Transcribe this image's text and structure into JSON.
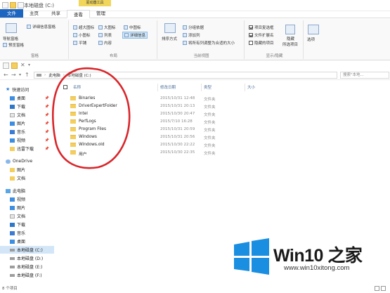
{
  "window": {
    "title": "本地磁盘 (C:)",
    "context_tab": "驱动器工具"
  },
  "ribbon_tabs": [
    "文件",
    "主页",
    "共享",
    "查看",
    "管理"
  ],
  "ribbon": {
    "panes": {
      "nav_pane": "导航窗格",
      "preview_pane": "预览窗格",
      "details_pane": "详细信息窗格",
      "label": "窗格"
    },
    "layout": {
      "items": [
        "超大图标",
        "大图标",
        "中图标",
        "小图标",
        "列表",
        "详细信息",
        "平铺",
        "内容"
      ],
      "selected": "详细信息",
      "label": "布局"
    },
    "current_view": {
      "sort": "排序方式",
      "group": "分组依据",
      "add_column": "添加列",
      "fit_columns": "将所有列调整为合适的大小",
      "label": "当前视图"
    },
    "show_hide": {
      "item_checkboxes": "项目复选框",
      "file_extensions": "文件扩展名",
      "hidden_items": "隐藏的项目",
      "hide": "隐藏",
      "selected_items": "所选项目",
      "options": "选项",
      "label": "显示/隐藏",
      "checked": {
        "item_checkboxes": true,
        "file_extensions": true,
        "hidden_items": false
      }
    }
  },
  "address": {
    "segments": [
      "此电脑",
      "本地磁盘 (C:)"
    ],
    "search_placeholder": "搜索\"本地..."
  },
  "nav_pane": {
    "quick_access": "快速访问",
    "quick_items": [
      "桌面",
      "下载",
      "文档",
      "图片",
      "音乐",
      "视频",
      "迅雷下载"
    ],
    "onedrive": "OneDrive",
    "onedrive_items": [
      "图片",
      "文档"
    ],
    "this_pc": "此电脑",
    "pc_items": [
      "视频",
      "图片",
      "文档",
      "下载",
      "音乐",
      "桌面"
    ],
    "drives": [
      "本地磁盘 (C:)",
      "本地磁盘 (D:)",
      "本地磁盘 (E:)",
      "本地磁盘 (F:)"
    ],
    "selected_drive": "本地磁盘 (C:)"
  },
  "file_list": {
    "columns": [
      "名称",
      "修改日期",
      "类型",
      "大小"
    ],
    "rows": [
      {
        "name": "Binaries",
        "date": "2015/10/31 12:48",
        "type": "文件夹"
      },
      {
        "name": "DriverExpertFolder",
        "date": "2015/10/31 20:13",
        "type": "文件夹"
      },
      {
        "name": "Intel",
        "date": "2015/10/30 20:47",
        "type": "文件夹"
      },
      {
        "name": "PerfLogs",
        "date": "2015/7/10 16:28",
        "type": "文件夹"
      },
      {
        "name": "Program Files",
        "date": "2015/10/31 20:59",
        "type": "文件夹"
      },
      {
        "name": "Windows",
        "date": "2015/10/31 20:56",
        "type": "文件夹"
      },
      {
        "name": "Windows.old",
        "date": "2015/10/30 22:22",
        "type": "文件夹"
      },
      {
        "name": "用户",
        "date": "2015/10/30 22:35",
        "type": "文件夹"
      }
    ]
  },
  "status": {
    "count": "8 个项目"
  },
  "watermark": {
    "title": "Win10 之家",
    "url": "www.win10xitong.com",
    "colors": {
      "logo": "#1a8ee0",
      "annotation": "#d9262b"
    }
  }
}
